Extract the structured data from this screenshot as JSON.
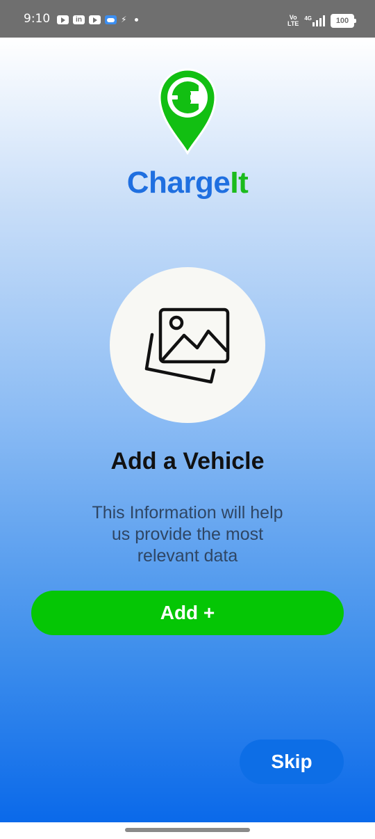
{
  "status_bar": {
    "time": "9:10",
    "left_icons": [
      "youtube-icon",
      "linkedin-icon",
      "youtube-icon",
      "weather-icon",
      "flash-icon",
      "dot-icon"
    ],
    "linkedin_text": "in",
    "volte_top": "Vo",
    "volte_bottom": "LTE",
    "network": "4G",
    "battery": "100"
  },
  "app": {
    "name_part1": "Charge",
    "name_part2": "It",
    "brand_blue": "#1f6fe0",
    "brand_green": "#1cbb1c"
  },
  "main": {
    "placeholder_icon": "image-gallery-icon",
    "heading": "Add a Vehicle",
    "description_lines": [
      "This Information will help",
      "us provide the most",
      "relevant data"
    ]
  },
  "buttons": {
    "add_label": "Add +",
    "skip_label": "Skip"
  },
  "colors": {
    "add_button": "#05c605",
    "skip_button": "#0d6ee6",
    "gradient_bottom": "#0a69ea"
  }
}
